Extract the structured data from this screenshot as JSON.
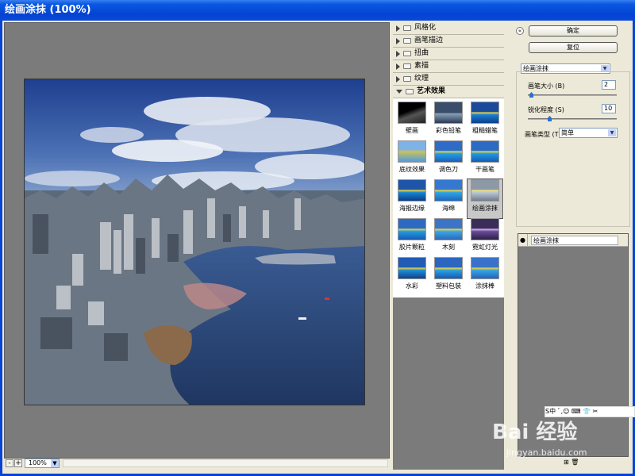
{
  "window": {
    "title": "绘画涂抹 (100%)"
  },
  "preview": {
    "zoom": "100%",
    "zoom_out": "-",
    "zoom_in": "+"
  },
  "filter_categories": [
    {
      "label": "风格化",
      "expanded": false
    },
    {
      "label": "画笔描边",
      "expanded": false
    },
    {
      "label": "扭曲",
      "expanded": false
    },
    {
      "label": "素描",
      "expanded": false
    },
    {
      "label": "纹理",
      "expanded": false
    },
    {
      "label": "艺术效果",
      "expanded": true
    }
  ],
  "artistic_filters": [
    {
      "label": "壁画",
      "selected": false
    },
    {
      "label": "彩色铅笔",
      "selected": false
    },
    {
      "label": "粗糙蜡笔",
      "selected": false
    },
    {
      "label": "底纹效果",
      "selected": false
    },
    {
      "label": "调色刀",
      "selected": false
    },
    {
      "label": "干画笔",
      "selected": false
    },
    {
      "label": "海报边缘",
      "selected": false
    },
    {
      "label": "海绵",
      "selected": false
    },
    {
      "label": "绘画涂抹",
      "selected": true
    },
    {
      "label": "胶片颗粒",
      "selected": false
    },
    {
      "label": "木刻",
      "selected": false
    },
    {
      "label": "霓虹灯光",
      "selected": false
    },
    {
      "label": "水彩",
      "selected": false
    },
    {
      "label": "塑料包装",
      "selected": false
    },
    {
      "label": "涂抹棒",
      "selected": false
    }
  ],
  "buttons": {
    "ok": "确定",
    "reset": "复位",
    "collapse": "«"
  },
  "settings": {
    "filter_select": "绘画涂抹",
    "brush_size_label": "画笔大小 (B)",
    "brush_size_value": "2",
    "sharpness_label": "锐化程度 (S)",
    "sharpness_value": "10",
    "brush_type_label": "画笔类型 (T):",
    "brush_type_value": "简单"
  },
  "layers": {
    "eye": "●",
    "name": "绘画涂抹",
    "new": "⊞",
    "delete": "🗑"
  },
  "watermark": {
    "toolbar": "S中 ﾞ,☺ ⌨ 👕 ✂",
    "logo": "Bai 经验",
    "url": "jingyan.baidu.com"
  },
  "colors": {
    "titlebar": "#0443d3",
    "canvas": "#7b7b7b",
    "dialog": "#ece9d8",
    "accent": "#2a6fd3"
  }
}
